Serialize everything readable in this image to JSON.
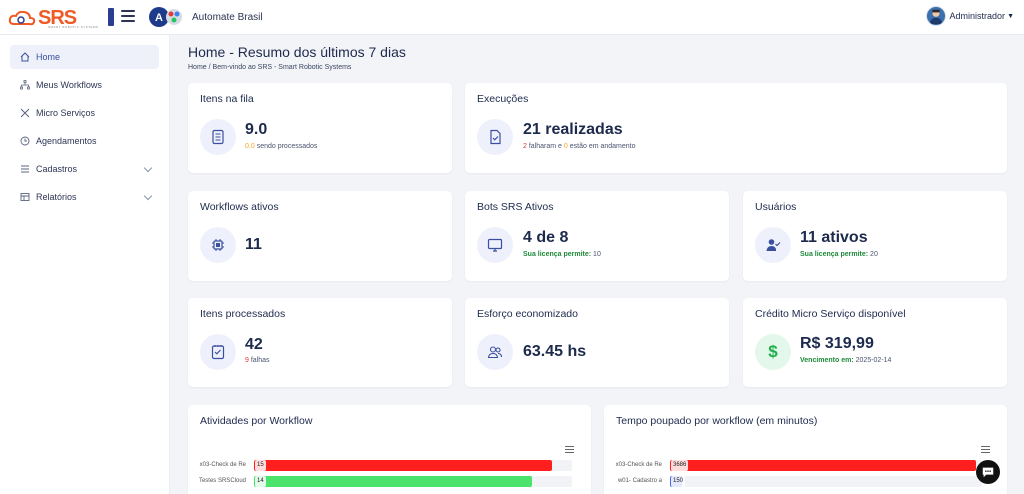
{
  "header": {
    "logo_text": "SRS",
    "logo_sub": "SMART ROBOTIC SYSTEMS",
    "tenant_name": "Automate Brasil",
    "user_name": "Administrador"
  },
  "sidebar": {
    "items": [
      {
        "label": "Home",
        "icon": "home-icon"
      },
      {
        "label": "Meus Workflows",
        "icon": "workflow-icon"
      },
      {
        "label": "Micro Serviços",
        "icon": "tools-icon"
      },
      {
        "label": "Agendamentos",
        "icon": "clock-icon"
      },
      {
        "label": "Cadastros",
        "icon": "list-icon"
      },
      {
        "label": "Relatórios",
        "icon": "report-icon"
      }
    ]
  },
  "page": {
    "title": "Home - Resumo dos últimos 7 dias",
    "breadcrumb_home": "Home",
    "breadcrumb_sep": "/",
    "breadcrumb_current": "Bem-vindo ao SRS - Smart Robotic Systems"
  },
  "cards": {
    "queue": {
      "title": "Itens na fila",
      "value": "9.0",
      "processing": "0.0",
      "processing_text": "sendo processados"
    },
    "executions": {
      "title": "Execuções",
      "value": "21 realizadas",
      "failed": "2",
      "failed_text": "falharam e",
      "running": "0",
      "running_text": "estão em andamento"
    },
    "workflows": {
      "title": "Workflows ativos",
      "value": "11"
    },
    "bots": {
      "title": "Bots SRS Ativos",
      "value": "4 de 8",
      "license_label": "Sua licença permite:",
      "license_value": "10"
    },
    "users": {
      "title": "Usuários",
      "value": "11 ativos",
      "license_label": "Sua licença permite:",
      "license_value": "20"
    },
    "processed": {
      "title": "Itens processados",
      "value": "42",
      "failures": "9",
      "failures_text": "falhas"
    },
    "effort": {
      "title": "Esforço economizado",
      "value": "63.45 hs"
    },
    "credit": {
      "title": "Crédito Micro Serviço disponível",
      "value": "R$ 319,99",
      "due_label": "Vencimento em:",
      "due_value": "2025-02-14"
    }
  },
  "charts": {
    "activities": {
      "title": "Atividades por Workflow",
      "bars": [
        {
          "label": "x03-Check de Re",
          "value": "15",
          "color": "#ff1f1f"
        },
        {
          "label": "Testes SRSCloud",
          "value": "14",
          "color": "#4be36b"
        }
      ]
    },
    "time_saved": {
      "title": "Tempo poupado por workflow (em minutos)",
      "bars": [
        {
          "label": "x03-Check de Re",
          "value": "3686",
          "color": "#ff1f1f"
        },
        {
          "label": "w01- Cadastro a",
          "value": "150",
          "color": "#4a68f0"
        }
      ]
    }
  },
  "chart_data": [
    {
      "type": "bar",
      "title": "Atividades por Workflow",
      "categories": [
        "x03-Check de Re",
        "Testes SRSCloud"
      ],
      "values": [
        15,
        14
      ]
    },
    {
      "type": "bar",
      "title": "Tempo poupado por workflow (em minutos)",
      "categories": [
        "x03-Check de Re",
        "w01- Cadastro a"
      ],
      "values": [
        3686,
        150
      ]
    }
  ]
}
